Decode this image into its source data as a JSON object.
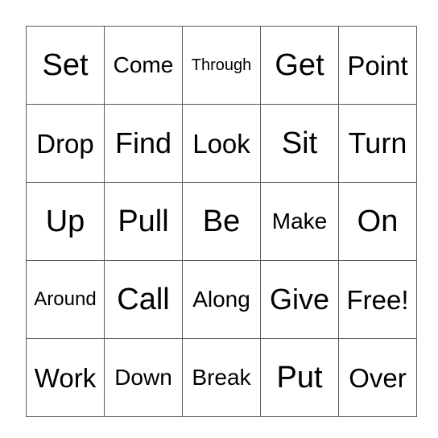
{
  "board": {
    "rows": [
      [
        "Set",
        "Come",
        "Through",
        "Get",
        "Point"
      ],
      [
        "Drop",
        "Find",
        "Look",
        "Sit",
        "Turn"
      ],
      [
        "Up",
        "Pull",
        "Be",
        "Make",
        "On"
      ],
      [
        "Around",
        "Call",
        "Along",
        "Give",
        "Free!"
      ],
      [
        "Work",
        "Down",
        "Break",
        "Put",
        "Over"
      ]
    ]
  }
}
